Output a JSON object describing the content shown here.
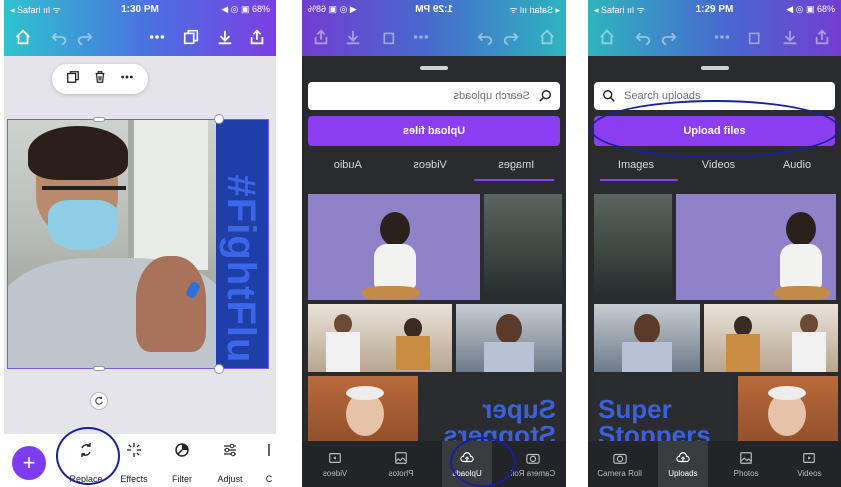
{
  "panel_left": {
    "status": {
      "left": "◂ Safari ııl ᯤ",
      "time": "1:30 PM",
      "right": "◀ ◎ ▣ 68%"
    },
    "toolbar_icons": [
      "home-icon",
      "undo-icon",
      "redo-icon",
      "more-icon",
      "layers-icon",
      "download-icon",
      "share-icon"
    ],
    "floating_toolbar_icons": [
      "duplicate-icon",
      "trash-icon",
      "more-icon"
    ],
    "design_text": {
      "hash": "#",
      "main": "FightFlu"
    },
    "tools": [
      {
        "label": "Replace",
        "icon": "replace-icon"
      },
      {
        "label": "Effects",
        "icon": "effects-icon"
      },
      {
        "label": "Filter",
        "icon": "filter-icon"
      },
      {
        "label": "Adjust",
        "icon": "adjust-icon"
      },
      {
        "label": "C",
        "icon": "crop-icon"
      }
    ],
    "fab_label": "+"
  },
  "panel_middle_mirrored": {
    "status": {
      "left": "◂ Safari ııl ᯤ",
      "time": "1:29 PM",
      "right": "◀ ◎ ▣ 68%"
    },
    "search": {
      "placeholder": "Search uploads"
    },
    "upload_label": "Upload files",
    "tabs": [
      "Images",
      "Videos",
      "Audio"
    ],
    "overlay_text": "Super Stoppers",
    "nav": [
      "Camera Roll",
      "Uploads",
      "Photos",
      "Videos"
    ]
  },
  "panel_right": {
    "status": {
      "left": "◂ Safari ııl ᯤ",
      "time": "1:29 PM",
      "right": "◀ ◎ ▣ 68%"
    },
    "search": {
      "placeholder": "Search uploads"
    },
    "upload_label": "Upload files",
    "tabs": [
      "Images",
      "Videos",
      "Audio"
    ],
    "overlay_text": "Super Stoppers",
    "nav": [
      "Camera Roll",
      "Uploads",
      "Photos",
      "Videos"
    ]
  },
  "colors": {
    "accent": "#8b3ef0",
    "annotation": "#1a1f9c",
    "panel_dark": "#2a2b2e"
  }
}
